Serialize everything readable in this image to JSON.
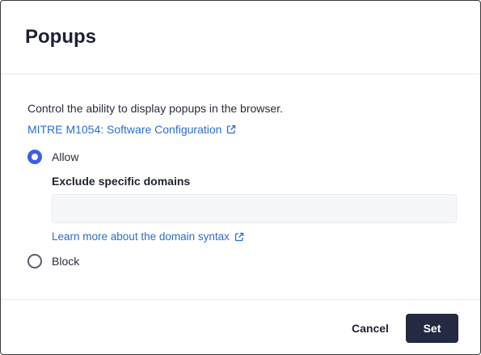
{
  "dialog": {
    "title": "Popups",
    "description": "Control the ability to display popups in the browser.",
    "mitre_link": {
      "label": "MITRE M1054: Software Configuration",
      "icon": "external-link-icon"
    },
    "options": [
      {
        "label": "Allow",
        "selected": true
      },
      {
        "label": "Block",
        "selected": false
      }
    ],
    "exclude": {
      "label": "Exclude specific domains",
      "value": "",
      "placeholder": ""
    },
    "domain_link": {
      "label": "Learn more about the domain syntax",
      "icon": "external-link-icon"
    },
    "buttons": {
      "cancel": "Cancel",
      "set": "Set"
    }
  },
  "colors": {
    "accent": "#3d5ee6",
    "link": "#2b6cd3",
    "primary_button": "#232a42"
  }
}
